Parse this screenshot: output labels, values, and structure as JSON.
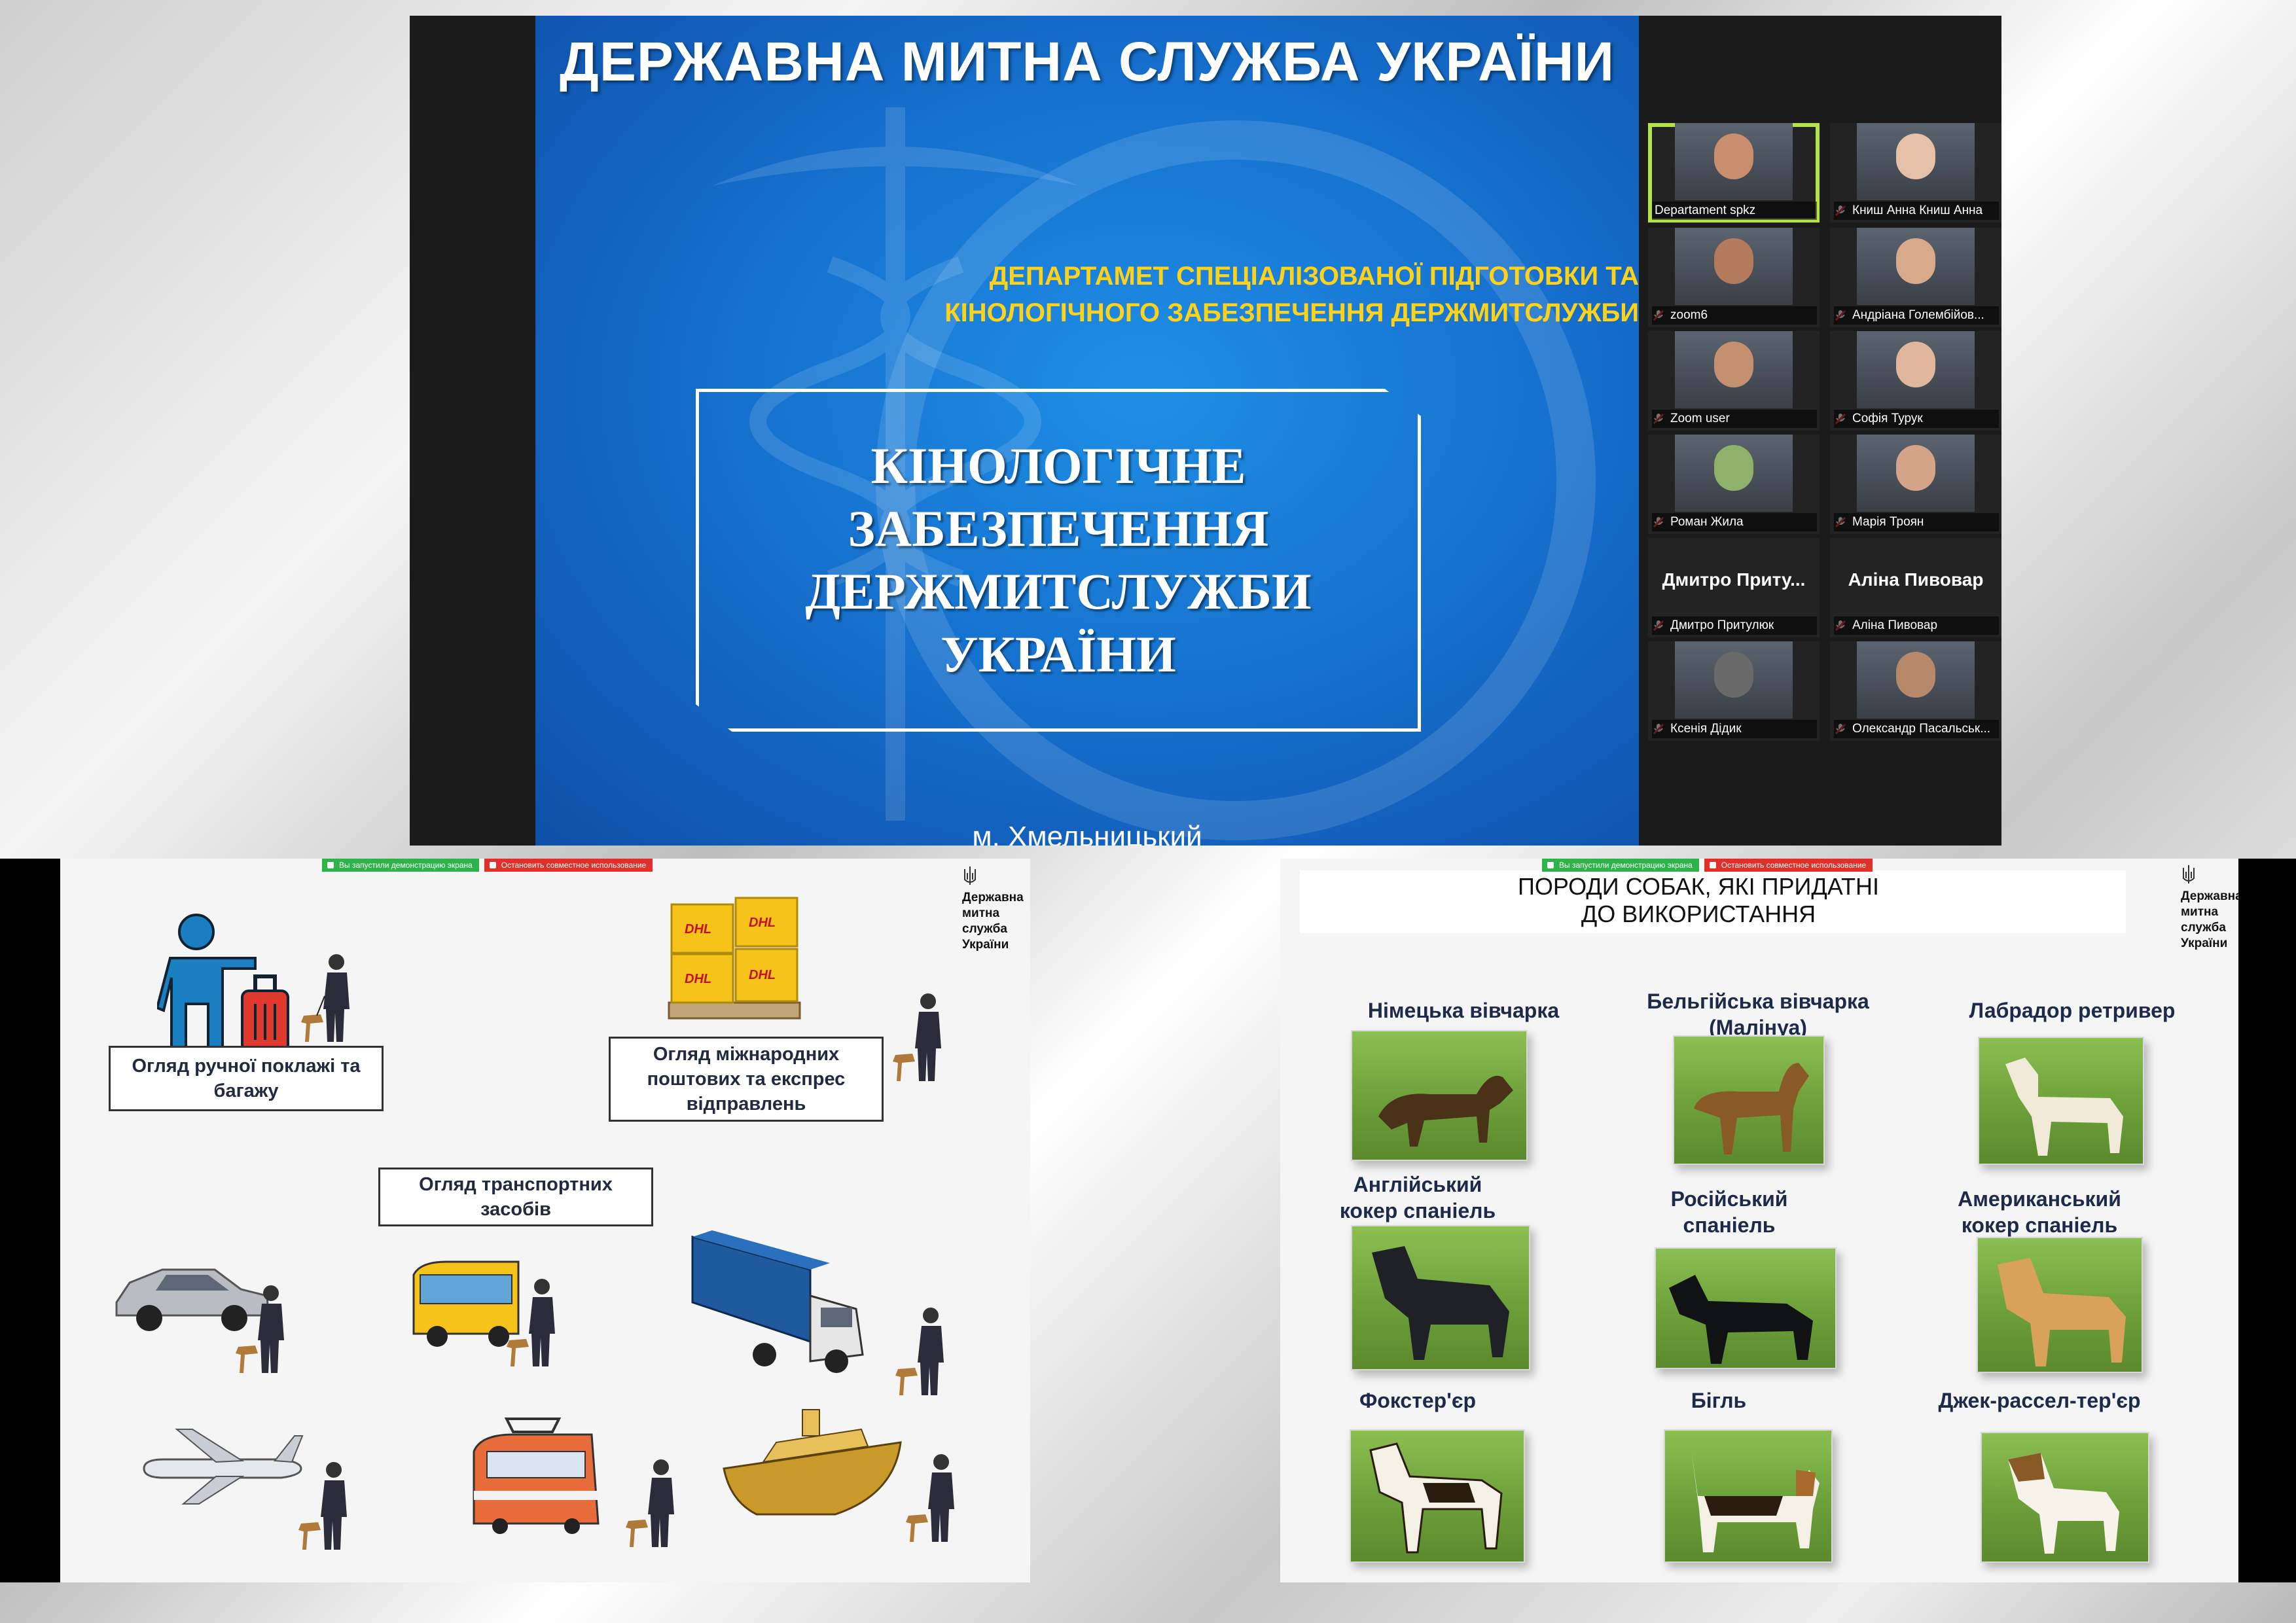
{
  "slide": {
    "title": "ДЕРЖАВНА МИТНА СЛУЖБА УКРАЇНИ",
    "department_line1": "ДЕПАРТАМЕТ СПЕЦІАЛІЗОВАНОЇ ПІДГОТОВКИ ТА",
    "department_line2": "КІНОЛОГІЧНОГО ЗАБЕЗПЕЧЕННЯ ДЕРЖМИТСЛУЖБИ",
    "main_line1": "КІНОЛОГІЧНЕ ЗАБЕЗПЕЧЕННЯ",
    "main_line2": "ДЕРЖМИТСЛУЖБИ УКРАЇНИ",
    "city": "м. Хмельницький"
  },
  "participants": [
    {
      "name": "Departament spkz",
      "active": true,
      "video": true,
      "muted": false
    },
    {
      "name": "Книш Анна Книш Анна",
      "active": false,
      "video": true,
      "muted": true
    },
    {
      "name": "zoom6",
      "active": false,
      "video": true,
      "muted": true
    },
    {
      "name": "Андріана Голембійов...",
      "active": false,
      "video": true,
      "muted": true
    },
    {
      "name": "Zoom user",
      "active": false,
      "video": true,
      "muted": true
    },
    {
      "name": "Софія Турук",
      "active": false,
      "video": true,
      "muted": true
    },
    {
      "name": "Роман Жила",
      "active": false,
      "video": true,
      "muted": true
    },
    {
      "name": "Марія Троян",
      "active": false,
      "video": true,
      "muted": true
    },
    {
      "name": "Дмитро  Притулюк",
      "display_name": "Дмитро  Приту...",
      "active": false,
      "video": false,
      "muted": true
    },
    {
      "name": "Аліна Пивовар",
      "display_name": "Аліна Пивовар",
      "active": false,
      "video": false,
      "muted": true
    },
    {
      "name": "Ксенія Дідик",
      "active": false,
      "video": true,
      "muted": true
    },
    {
      "name": "Олександр Пасальськ...",
      "active": false,
      "video": true,
      "muted": true
    }
  ],
  "share_bar": {
    "sharing": "Вы запустили демонстрацию экрана",
    "stop": "Остановить совместное использование"
  },
  "customs_label": {
    "line1": "Державна",
    "line2": "митна служба",
    "line3": "України"
  },
  "inspection": {
    "baggage": "Огляд ручної поклажі та багажу",
    "postal": "Огляд міжнародних поштових та експрес відправлень",
    "vehicles": "Огляд транспортних засобів",
    "box_brand": "DHL"
  },
  "breeds": {
    "title_line1": "ПОРОДИ СОБАК, ЯКІ ПРИДАТНІ",
    "title_line2": "ДО ВИКОРИСТАННЯ",
    "items": [
      {
        "label_1": "Німецька вівчарка",
        "label_2": ""
      },
      {
        "label_1": "Бельгійська вівчарка",
        "label_2": "(Малінуа)"
      },
      {
        "label_1": "Лабрадор ретривер",
        "label_2": ""
      },
      {
        "label_1": "Англійський",
        "label_2": "кокер спаніель"
      },
      {
        "label_1": "Російський",
        "label_2": "спаніель"
      },
      {
        "label_1": "Американський",
        "label_2": "кокер спаніель"
      },
      {
        "label_1": "Фокстер'єр",
        "label_2": ""
      },
      {
        "label_1": "Бігль",
        "label_2": ""
      },
      {
        "label_1": "Джек-рассел-тер'єр",
        "label_2": ""
      }
    ]
  },
  "colors": {
    "slide_blue": "#1672cf",
    "dept_yellow": "#ffd21a",
    "active_speaker": "#b5e24b",
    "breed_label": "#1d2a4a"
  }
}
